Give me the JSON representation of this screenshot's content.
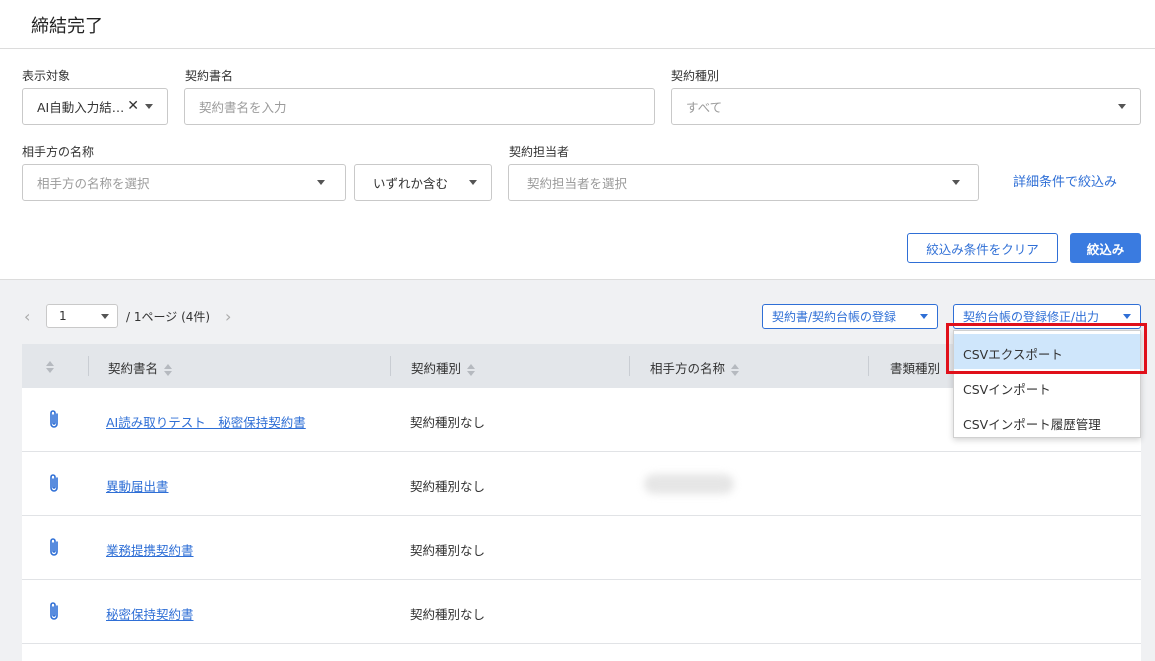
{
  "page": {
    "title": "締結完了"
  },
  "filters": {
    "target": {
      "label": "表示対象",
      "value": "AI自動入力結…"
    },
    "contract_name": {
      "label": "契約書名",
      "placeholder": "契約書名を入力"
    },
    "contract_type": {
      "label": "契約種別",
      "value": "すべて"
    },
    "counterparty": {
      "label": "相手方の名称",
      "placeholder": "相手方の名称を選択"
    },
    "match_mode": {
      "value": "いずれか含む"
    },
    "owner": {
      "label": "契約担当者",
      "placeholder": "契約担当者を選択"
    },
    "detail_link": "詳細条件で絞込み",
    "clear_button": "絞込み条件をクリア",
    "apply_button": "絞込み"
  },
  "pagination": {
    "current_page": "1",
    "summary": "/ 1ページ (4件)"
  },
  "toolbar": {
    "register_button": "契約書/契約台帳の登録",
    "edit_export_button": "契約台帳の登録修正/出力"
  },
  "dropdown": {
    "items": [
      "CSVエクスポート",
      "CSVインポート",
      "CSVインポート履歴管理"
    ],
    "active_index": 0
  },
  "table": {
    "columns": [
      "契約書名",
      "契約種別",
      "相手方の名称",
      "書類種別"
    ],
    "rows": [
      {
        "name": "AI読み取りテスト　秘密保持契約書",
        "type": "契約種別なし"
      },
      {
        "name": "異動届出書",
        "type": "契約種別なし"
      },
      {
        "name": "業務提携契約書",
        "type": "契約種別なし"
      },
      {
        "name": "秘密保持契約書",
        "type": "契約種別なし"
      }
    ]
  },
  "colors": {
    "accent": "#2f6fd6",
    "primary_button": "#3a7be0",
    "highlight": "#e0101a",
    "active_item": "#cfe6fb"
  }
}
